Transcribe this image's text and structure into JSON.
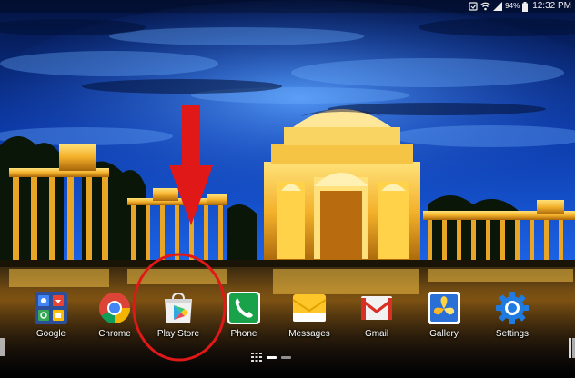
{
  "status_bar": {
    "battery": "94%",
    "time": "12:32 PM",
    "icons": [
      "notification-icon",
      "wifi-icon",
      "signal-icon",
      "battery-icon"
    ]
  },
  "dock": {
    "apps": [
      {
        "label": "Google",
        "icon": "google-folder-icon"
      },
      {
        "label": "Chrome",
        "icon": "chrome-icon"
      },
      {
        "label": "Play Store",
        "icon": "play-store-icon"
      },
      {
        "label": "Phone",
        "icon": "phone-icon"
      },
      {
        "label": "Messages",
        "icon": "messages-icon"
      },
      {
        "label": "Gmail",
        "icon": "gmail-icon"
      },
      {
        "label": "Gallery",
        "icon": "gallery-icon"
      },
      {
        "label": "Settings",
        "icon": "settings-icon"
      }
    ]
  },
  "page_indicator": {
    "pages": 2,
    "active_page": 1
  },
  "annotation": {
    "color": "#e01818",
    "highlighted_app": "Play Store"
  }
}
